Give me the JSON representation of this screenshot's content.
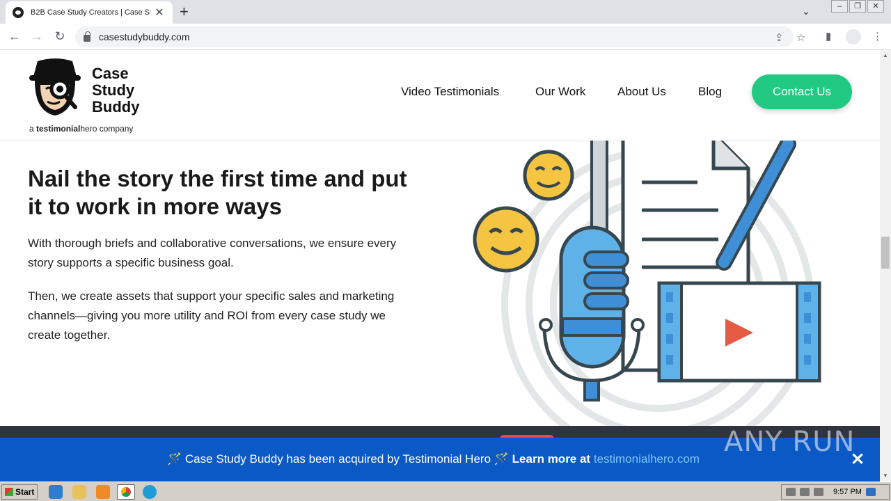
{
  "browser": {
    "tab_title": "B2B Case Study Creators | Case Stu",
    "url": "casestudybuddy.com"
  },
  "site": {
    "logo": {
      "line1": "Case",
      "line2": "Study",
      "line3": "Buddy",
      "tagline_prefix": "a ",
      "tagline_bold": "testimonial",
      "tagline_rest": "hero company"
    },
    "nav": [
      "Video Testimonials",
      "Our Work",
      "About Us",
      "Blog"
    ],
    "cta": "Contact Us"
  },
  "hero": {
    "title": "Nail the story the first time and put it to work in more ways",
    "para1": "With thorough briefs and collaborative conversations, we ensure every story supports a specific business goal.",
    "para2": "Then, we create assets that support your specific sales and marketing channels—giving you more utility and ROI from every case study we create together."
  },
  "banner": {
    "text": "Case Study Buddy has been acquired by Testimonial Hero",
    "learn": "Learn more at",
    "link": "testimonialhero.com",
    "emoji": "🪄"
  },
  "watermark": "ANY RUN",
  "taskbar": {
    "start": "Start",
    "clock": "9:57 PM"
  },
  "colors": {
    "accent": "#21c983",
    "banner": "#0b59c4",
    "illustration_blue": "#3f8fd6",
    "smiley": "#f5c542",
    "play": "#e45a43"
  }
}
